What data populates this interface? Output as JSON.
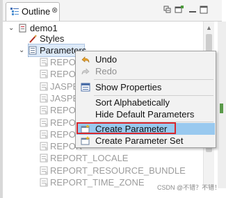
{
  "tab": {
    "title": "Outline",
    "close_glyph": "⊗"
  },
  "toolbar": {
    "icons": [
      "collapse-all-icon",
      "view-menu-icon",
      "minimize-icon",
      "maximize-icon"
    ]
  },
  "tree": {
    "root": "demo1",
    "styles": "Styles",
    "parameters": "Parameters",
    "children": [
      "REPORT_",
      "REPOR",
      "JASPE",
      "JASPE",
      "REPOR",
      "REPOR",
      "REPOR",
      "REPOR",
      "REPORT_LOCALE",
      "REPORT_RESOURCE_BUNDLE",
      "REPORT_TIME_ZONE"
    ]
  },
  "context_menu": {
    "items": [
      {
        "label": "Undo",
        "icon": "undo-icon",
        "enabled": true
      },
      {
        "label": "Redo",
        "icon": "redo-icon",
        "enabled": false
      },
      {
        "label": "Show Properties",
        "icon": "properties-icon",
        "enabled": true
      },
      {
        "label": "Sort Alphabetically",
        "icon": "",
        "enabled": true
      },
      {
        "label": "Hide Default Parameters",
        "icon": "",
        "enabled": true
      },
      {
        "label": "Create Parameter",
        "icon": "create-parameter-icon",
        "enabled": true,
        "highlighted": true
      },
      {
        "label": "Create Parameter Set",
        "icon": "create-parameter-set-icon",
        "enabled": true
      }
    ]
  },
  "watermark": "CSDN @不错？不错！",
  "colors": {
    "menu_highlight": "#99c9ef",
    "red_annotation": "#d9262b",
    "selection": "#dce9f8"
  }
}
